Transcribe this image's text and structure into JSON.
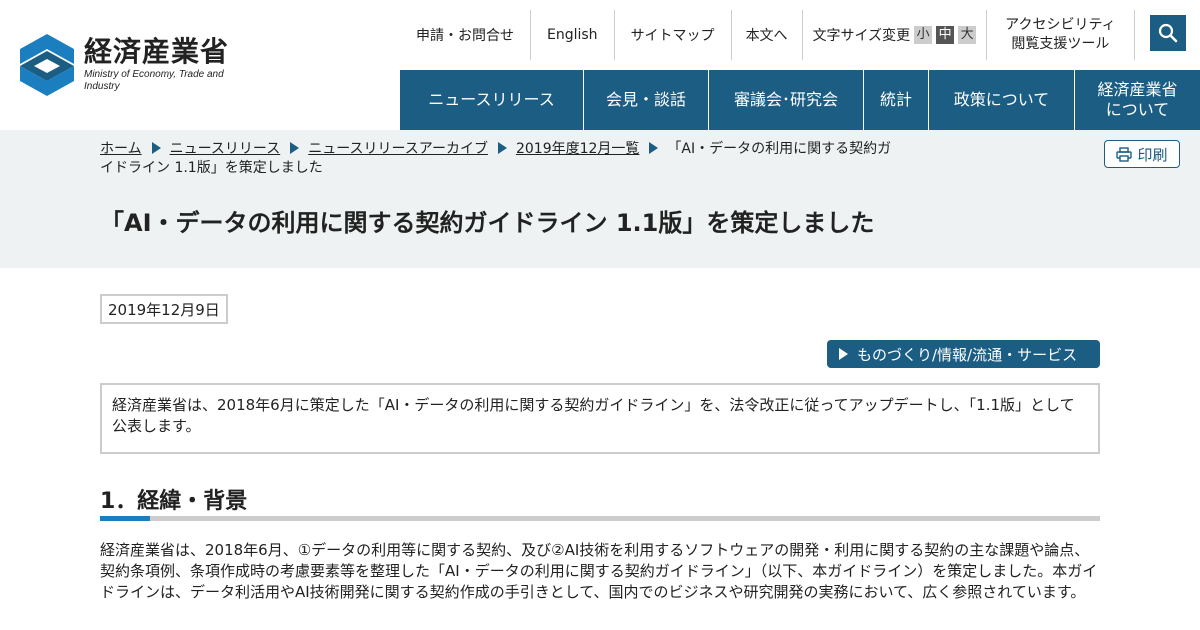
{
  "logo": {
    "name_ja": "経済産業省",
    "name_en": "Ministry of Economy, Trade and Industry"
  },
  "utility": {
    "contact": "申請・お問合せ",
    "english": "English",
    "sitemap": "サイトマップ",
    "skip": "本文へ",
    "fontsize_label": "文字サイズ変更",
    "fontsize_small": "小",
    "fontsize_medium": "中",
    "fontsize_large": "大",
    "a11y_line1": "アクセシビリティ",
    "a11y_line2": "閲覧支援ツール"
  },
  "gnav": [
    {
      "label": "ニュースリリース"
    },
    {
      "label": "会見・談話"
    },
    {
      "label": "審議会･研究会"
    },
    {
      "label": "統計"
    },
    {
      "label": "政策について"
    },
    {
      "label_line1": "経済産業省",
      "label_line2": "について"
    }
  ],
  "breadcrumb": {
    "items": [
      "ホーム",
      "ニュースリリース",
      "ニュースリリースアーカイブ",
      "2019年度12月一覧"
    ],
    "current": "「AI・データの利用に関する契約ガイドライン 1.1版」を策定しました"
  },
  "print_label": "印刷",
  "page_title": "「AI・データの利用に関する契約ガイドライン 1.1版」を策定しました",
  "date": "2019年12月9日",
  "category": "ものづくり/情報/流通・サービス",
  "summary": "経済産業省は、2018年6月に策定した「AI・データの利用に関する契約ガイドライン」を、法令改正に従ってアップデートし、「1.1版」として公表します。",
  "section1": {
    "heading": "1．経緯・背景",
    "body": "経済産業省は、2018年6月、①データの利用等に関する契約、及び②AI技術を利用するソフトウェアの開発・利用に関する契約の主な課題や論点、契約条項例、条項作成時の考慮要素等を整理した「AI・データの利用に関する契約ガイドライン」（以下、本ガイドライン）を策定しました。本ガイドラインは、データ利活用やAI技術開発に関する契約作成の手引きとして、国内でのビジネスや研究開発の実務において、広く参照されています。"
  },
  "colors": {
    "brand": "#1b5d83",
    "accent": "#1b7fbf",
    "band_bg": "#eef2f2"
  }
}
